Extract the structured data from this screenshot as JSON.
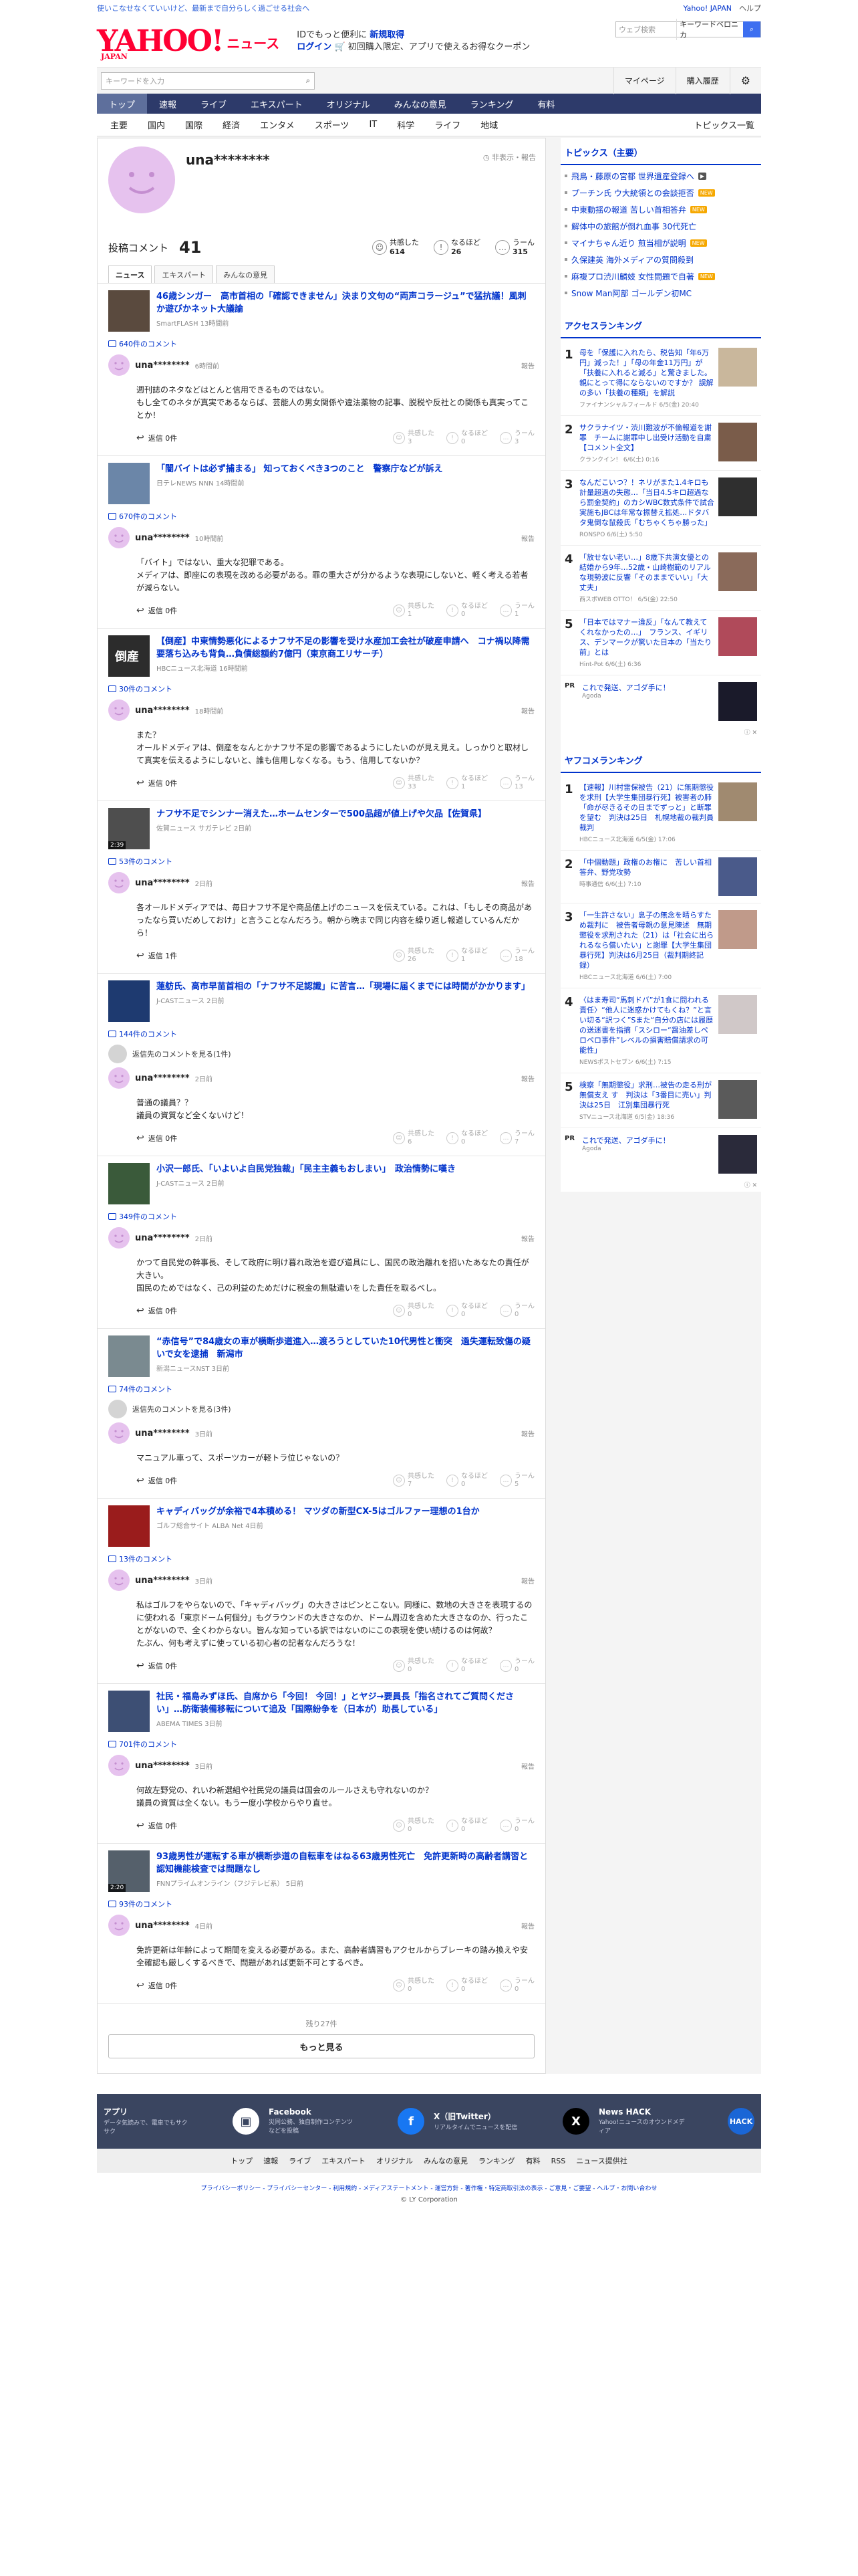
{
  "top": {
    "strip_left": "使いこなせなくていいけど、最新まで自分らしく過ごせる社会へ",
    "links": [
      "Yahoo! JAPAN",
      "ヘルプ"
    ]
  },
  "mast": {
    "logo_text": "YAHOO!",
    "logo_sub": "JAPAN",
    "logo_section": "ニュース",
    "promo_line1_a": "IDでもっと便利に",
    "promo_line1_b": "新規取得",
    "promo_login": "ログイン",
    "promo_line2": "初回購入限定、アプリで使えるお得なクーポン",
    "web_search_placeholder": "ウェブ検索",
    "keyword": "キーワードベロニカ"
  },
  "search_row": {
    "placeholder": "キーワードを入力",
    "buttons": [
      "マイページ",
      "購入履歴"
    ]
  },
  "main_nav": [
    "トップ",
    "速報",
    "ライブ",
    "エキスパート",
    "オリジナル",
    "みんなの意見",
    "ランキング",
    "有料"
  ],
  "sub_nav": [
    "主要",
    "国内",
    "国際",
    "経済",
    "エンタメ",
    "スポーツ",
    "IT",
    "科学",
    "ライフ",
    "地域"
  ],
  "sub_nav_right": "トピックス一覧",
  "profile": {
    "username": "una********",
    "reported_label": "非表示・報告",
    "comments_label": "投稿コメント",
    "comments_count": "41",
    "reactions": [
      {
        "icon": "☺",
        "label": "共感した",
        "count": "614"
      },
      {
        "icon": "!",
        "label": "なるほど",
        "count": "26"
      },
      {
        "icon": "…",
        "label": "うーん",
        "count": "315"
      }
    ],
    "tabs": [
      "ニュース",
      "エキスパート",
      "みんなの意見"
    ]
  },
  "reaction_labels": [
    "共感した",
    "なるほど",
    "うーん"
  ],
  "report_label": "報告",
  "reply_label": "返信",
  "comments": [
    {
      "thumb_color": "#5a4a3e",
      "title": "46歳シンガー　高市首相の「確認できません」決まり文句の“両声コラージュ”で猛抗議！風刺か遊びかネット大議論",
      "source": "SmartFLASH 13時間前",
      "comment_count": "640件のコメント",
      "user": "una********",
      "time": "6時間前",
      "text": "週刊誌のネタなどはとんと信用できるものではない。\nもし全てのネタが真実であるならば、芸能人の男女関係や違法薬物の記事、脱税や反社との関係も真実ってことか！",
      "reply": "返信 0件",
      "r": [
        "3",
        "0",
        "3"
      ]
    },
    {
      "thumb_color": "#6b86a8",
      "title": "「闇バイトは必ず捕まる」 知っておくべき3つのこと　警察庁などが訴え",
      "source": "日テレNEWS NNN 14時間前",
      "comment_count": "670件のコメント",
      "user": "una********",
      "time": "10時間前",
      "text": "「バイト」ではない、重大な犯罪である。\nメディアは、即座にの表現を改める必要がある。罪の重大さが分かるような表現にしないと、軽く考える若者が減らない。",
      "reply": "返信 0件",
      "r": [
        "1",
        "0",
        "1"
      ]
    },
    {
      "thumb_color": "#2c2c2c",
      "thumb_text": "倒産",
      "title": "【倒産】中東情勢悪化によるナフサ不足の影響を受け水産加工会社が破産申請へ　コナ禍以降需要落ち込みも背負…負債総額約7億円（東京商工リサーチ）",
      "source": "HBCニュース北海道 16時間前",
      "comment_count": "30件のコメント",
      "user": "una********",
      "time": "18時間前",
      "text": "また？\nオールドメディアは、倒産をなんとかナフサ不足の影響であるようにしたいのが見え見え。しっかりと取材して真実を伝えるようにしないと、誰も信用しなくなる。もう、信用してないか？",
      "reply": "返信 0件",
      "r": [
        "33",
        "1",
        "13"
      ]
    },
    {
      "thumb_color": "#4e4e4e",
      "duration": "2:39",
      "title": "ナフサ不足でシンナー消えた…ホームセンターで500品超が値上げや欠品【佐賀県】",
      "source": "佐賀ニュース サガテレビ 2日前",
      "comment_count": "53件のコメント",
      "user": "una********",
      "time": "2日前",
      "text": "各オールドメディアでは、毎日ナフサ不足や商品値上げのニュースを伝えている。これは、「もしその商品があったなら買いだめしておけ」と言うことなんだろう。朝から晩まで同じ内容を繰り返し報道しているんだから！",
      "reply": "返信 1件",
      "r": [
        "26",
        "1",
        "18"
      ]
    },
    {
      "thumb_color": "#1e3a70",
      "title": "蓮舫氏、高市早苗首相の「ナフサ不足認識」に苦言…「現場に届くまでには時間がかかります」",
      "source": "J-CASTニュース 2日前",
      "comment_count": "144件のコメント",
      "others": "返信先のコメントを見る(1件)",
      "user": "una********",
      "time": "2日前",
      "text": "普通の議員？？\n議員の資質など全くないけど！",
      "reply": "返信 0件",
      "r": [
        "6",
        "0",
        "7"
      ]
    },
    {
      "thumb_color": "#3a5a3a",
      "title": "小沢一郎氏、「いよいよ自民党独裁」「民主主義もおしまい」　政治情勢に嘆き",
      "source": "J-CASTニュース 2日前",
      "comment_count": "349件のコメント",
      "user": "una********",
      "time": "2日前",
      "text": "かつて自民党の幹事長、そして政府に明け暮れ政治を遊び道具にし、国民の政治離れを招いたあなたの責任が大きい。\n国民のためではなく、己の利益のためだけに税金の無駄遣いをした責任を取るべし。",
      "reply": "返信 0件",
      "r": [
        "0",
        "0",
        "0"
      ]
    },
    {
      "thumb_color": "#7a8a90",
      "title": "“赤信号”で84歳女の車が横断歩道進入…渡ろうとしていた10代男性と衝突　過失運転致傷の疑いで女を逮捕　新潟市",
      "source": "新潟ニュースNST 3日前",
      "comment_count": "74件のコメント",
      "others": "返信先のコメントを見る(3件)",
      "user": "una********",
      "time": "3日前",
      "text": "マニュアル車って、スポーツカーが軽トラ位じゃないの？",
      "reply": "返信 0件",
      "r": [
        "7",
        "0",
        "5"
      ]
    },
    {
      "thumb_color": "#9a1c1c",
      "title": "キャディバッグが余裕で4本積める！ マツダの新型CX-5はゴルファー理想の1台か",
      "source": "ゴルフ総合サイト ALBA Net 4日前",
      "comment_count": "13件のコメント",
      "user": "una********",
      "time": "3日前",
      "text": "私はゴルフをやらないので、「キャディバッグ」の大きさはピンとこない。同様に、数地の大きさを表現するのに使われる「東京ドーム何個分」もグラウンドの大きさなのか、ドーム周辺を含めた大きさなのか、行ったことがないので、全くわからない。皆んな知っている訳ではないのにこの表現を使い続けるのは何故？\nたぶん、何も考えずに使っている初心者の記者なんだろうな！",
      "reply": "返信 0件",
      "r": [
        "0",
        "0",
        "0"
      ]
    },
    {
      "thumb_color": "#3d4f74",
      "title": "社民・福島みずほ氏、自席から「今回！ 今回！」とヤジ→要員長「指名されてご質問ください」…防衛装備移転について追及「国際紛争を（日本が）助長している」",
      "source": "ABEMA TIMES 3日前",
      "comment_count": "701件のコメント",
      "user": "una********",
      "time": "3日前",
      "text": "何故左野党の、れいわ新選組や社民党の議員は国会のルールさえも守れないのか？\n議員の資質は全くない。もう一度小学校からやり直せ。",
      "reply": "返信 0件",
      "r": [
        "0",
        "0",
        "0"
      ]
    },
    {
      "thumb_color": "#55606b",
      "duration": "2:20",
      "title": "93歳男性が運転する車が横断歩道の自転車をはねる63歳男性死亡　免許更新時の高齢者講習と認知機能検査では問題なし",
      "source": "FNNプライムオンライン（フジテレビ系） 5日前",
      "comment_count": "93件のコメント",
      "user": "una********",
      "time": "4日前",
      "text": "免許更新は年齢によって期間を変える必要がある。また、高齢者講習もアクセルからブレーキの踏み換えや安全確認も厳しくするべきで、問題があれば更新不可とするべき。",
      "reply": "返信 0件",
      "r": [
        "0",
        "0",
        "0"
      ]
    }
  ],
  "remaining": "残り27件",
  "more_button": "もっと見る",
  "sidebar": {
    "topics_heading": "トピックス（主要）",
    "topics": [
      {
        "t": "飛鳥・藤原の宮都 世界遺産登録へ",
        "tag": "▶",
        "tagc": "v"
      },
      {
        "t": "プーチン氏 ウ大統領との会談拒否",
        "tag": "NEW",
        "tagc": ""
      },
      {
        "t": "中東動揺の報道 苦しい首相答弁",
        "tag": "NEW",
        "tagc": ""
      },
      {
        "t": "解体中の旅館が倒れ血事 30代死亡",
        "tag": "",
        "tagc": ""
      },
      {
        "t": "マイナちゃん近り 煎当相が説明",
        "tag": "NEW",
        "tagc": ""
      },
      {
        "t": "久保建英 海外メディアの質問殺到",
        "tag": "",
        "tagc": ""
      },
      {
        "t": "麻複プロ渋川麟妓 女性問題で自著",
        "tag": "NEW",
        "tagc": ""
      },
      {
        "t": "Snow Man阿部 ゴールデン初MC",
        "tag": "",
        "tagc": ""
      }
    ],
    "access_heading": "アクセスランキング",
    "access": [
      {
        "n": "1",
        "t": "母を「保護に入れたら、税告知「年6万円」減った！」「母の年金11万円」が「扶養に入れると滅る」と驚きました。親にとって得にならないのですか？ 誤解の多い「扶養の種類」を解説",
        "s": "ファイナンシャルフィールド 6/5(金) 20:40",
        "c": "#c9b79c"
      },
      {
        "n": "2",
        "t": "サクラナイツ・渋川難波が不倫報道を謝罪　チームに謝罪中し出受け活動を自粛【コメント全文】",
        "s": "クランクイン！ 6/6(土) 0:16",
        "c": "#7a5c4a"
      },
      {
        "n": "3",
        "t": "なんだこいつ？！ネリがまた1.4キロも計量超過の失態…「当日4.5キロ超過なら罰金契約」のカシWBC数式条件で試合実施もJBCは年常な振替え拡処…ドタバタ鬼倒な鼠殺氏「むちゃくちゃ勝った」",
        "s": "RONSPO 6/6(土) 5:50",
        "c": "#2f2f2f"
      },
      {
        "n": "4",
        "t": "「放せない老い…」8歳下共演女優との結婚から9年…52歳・山崎樹範のリアルな現勢波に反響「そのままでいい」「大丈夫」",
        "s": "西スポWEB OTTO！ 6/5(金) 22:50",
        "c": "#8a6a5a"
      },
      {
        "n": "5",
        "t": "「日本ではマナー違反」「なんて教えてくれなかったの…」　フランス、イギリス、デンマークが驚いた日本の「当たり前」とは",
        "s": "Hint-Pot 6/6(土) 6:36",
        "c": "#b04a5a"
      }
    ],
    "pr": {
      "p": "PR",
      "t": "これで発送、アゴダ手に！",
      "s": "Agoda"
    },
    "yafuko_heading": "ヤフコメランキング",
    "yafuko": [
      {
        "n": "1",
        "t": "【速報】川村雷保被告（21）に無期懲役を求刑【大学生集団暴行死】被害者の肺「命が尽きるその日までずっと」と断罪を望む　判決は25日　札幌地裁の裁判員裁判",
        "s": "HBCニュース北海道 6/5(金) 17:06",
        "c": "#a08a70"
      },
      {
        "n": "2",
        "t": "「中個動題」政権のお権に　苦しい首相答弁、野党攻勢",
        "s": "時事通信 6/6(土) 7:10",
        "c": "#4a5a8a"
      },
      {
        "n": "3",
        "t": "「一生許さない」息子の無念を晴らすため裁判に　被告者母親の意見陳述　無期懲役を求刑された（21）は「社会に出られるなら償いたい」と謝罪【大学生集団暴行死】判決は6月25日（裁判期終記録）",
        "s": "HBCニュース北海道 6/6(土) 7:00",
        "c": "#c09a8a"
      },
      {
        "n": "4",
        "t": "〈はま寿司“馬刺ドバ”が1食に問われる責任〉“他人に迷惑かけてもくね？”と言い切る“訳つく”Sまた“自分の店には履歴の送迷書を指摘「スシロー“醤油差しペロペロ事件”レベルの損害賠償請求の可能性」",
        "s": "NEWSポストセブン 6/6(土) 7:15",
        "c": "#d0c8c8"
      },
      {
        "n": "5",
        "t": "検察「無期懲役」求刑…被告の走る刑が無償支え す　判決は「3番目に売い」判決は25日　江別集団暴行死",
        "s": "STVニュース北海道 6/5(金) 18:36",
        "c": "#5a5a5a"
      }
    ]
  },
  "footer": {
    "apps": [
      {
        "t": "アプリ",
        "d": "データ気読みで、電車でもサクサク",
        "ic": "▣",
        "bg": "#fff",
        "fg": "#3a4560"
      },
      {
        "t": "Facebook",
        "d": "災同公務、独自制作コンテンツなどを投稿",
        "ic": "f",
        "bg": "#1877f2",
        "fg": "#fff"
      },
      {
        "t": "X（旧Twitter）",
        "d": "リアルタイムでニュースを配信",
        "ic": "X",
        "bg": "#000",
        "fg": "#fff"
      },
      {
        "t": "News HACK",
        "d": "Yahoo!ニュースのオウンドメディア",
        "ic": "HACK",
        "bg": "#1a66d6",
        "fg": "#fff"
      }
    ],
    "nav": [
      "トップ",
      "速報",
      "ライブ",
      "エキスパート",
      "オリジナル",
      "みんなの意見",
      "ランキング",
      "有料",
      "RSS",
      "ニュース提供社"
    ],
    "legal": "プライバシーポリシー - プライバシーセンター - 利用規約 - メディアステートメント - 運営方針 - 著作権・特定商取引法の表示 - ご意見・ご要望 - ヘルプ・お問い合わせ",
    "copyright": "© LY Corporation"
  }
}
